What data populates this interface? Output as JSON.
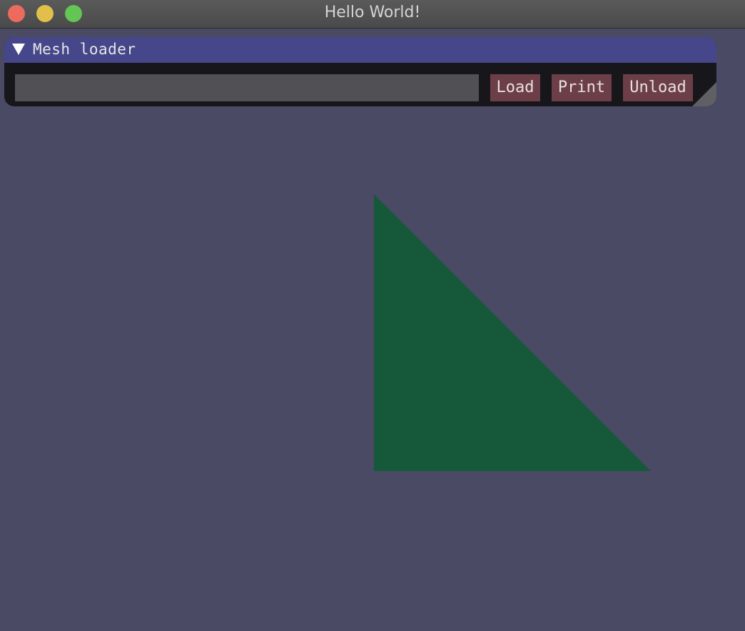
{
  "window": {
    "title": "Hello World!"
  },
  "mesh_loader": {
    "title": "Mesh loader",
    "path_input": {
      "value": "",
      "placeholder": ""
    },
    "buttons": {
      "load": "Load",
      "print": "Print",
      "unload": "Unload"
    }
  },
  "scene": {
    "background_color": "#4b4a64",
    "triangle_color": "#15583a"
  },
  "icons": {
    "collapse": "triangle-down-icon",
    "resize": "resize-grip-icon"
  }
}
